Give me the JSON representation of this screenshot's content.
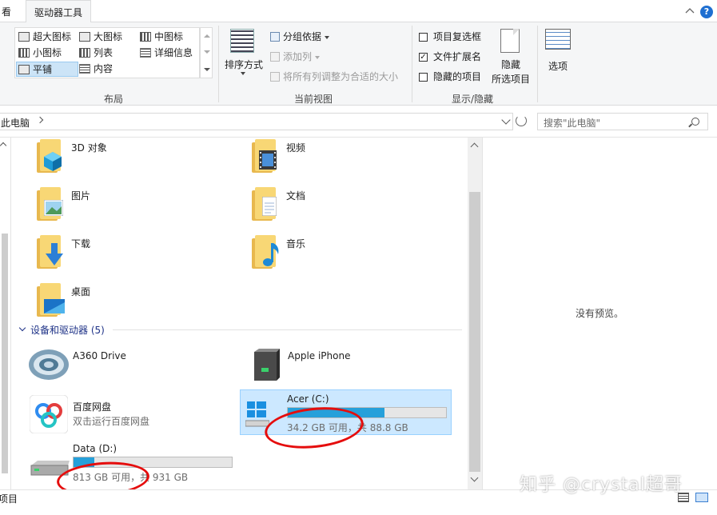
{
  "tabs": {
    "view": "看",
    "drive_tools": "驱动器工具"
  },
  "help_label": "?",
  "layout": {
    "group_label": "布局",
    "items": [
      "超大图标",
      "大图标",
      "中图标",
      "小图标",
      "列表",
      "详细信息",
      "平铺",
      "内容"
    ]
  },
  "current_view": {
    "group_label": "当前视图",
    "sort_label": "排序方式",
    "group_by": "分组依据",
    "add_column": "添加列",
    "fit_columns": "将所有列调整为合适的大小"
  },
  "show_hide": {
    "group_label": "显示/隐藏",
    "item_checkboxes": "项目复选框",
    "file_extensions": "文件扩展名",
    "hidden_items": "隐藏的项目",
    "file_extensions_checked": true,
    "check_mark": "✓",
    "hide_selected_line1": "隐藏",
    "hide_selected_line2": "所选项目"
  },
  "options_label": "选项",
  "address": {
    "path": "此电脑",
    "search_placeholder": "搜索\"此电脑\""
  },
  "folders": [
    "3D 对象",
    "视频",
    "图片",
    "文档",
    "下载",
    "音乐",
    "桌面"
  ],
  "devices_section": "设备和驱动器 (5)",
  "devices": [
    {
      "name": "A360 Drive"
    },
    {
      "name": "Apple iPhone"
    },
    {
      "name": "百度网盘",
      "sub": "双击运行百度网盘"
    },
    {
      "name": "Acer (C:)",
      "sub": "34.2 GB 可用，共 88.8 GB",
      "used_fraction": 0.61
    },
    {
      "name": "Data (D:)",
      "sub": "813 GB 可用，共 931 GB",
      "used_fraction": 0.13
    }
  ],
  "preview_text": "没有预览。",
  "status_text": "项目",
  "watermark": "知乎 @crystal超哥",
  "colors": {
    "accent": "#26a0da",
    "selection": "#cce8ff",
    "section": "#1e3287",
    "annotation": "#e50d0d"
  }
}
